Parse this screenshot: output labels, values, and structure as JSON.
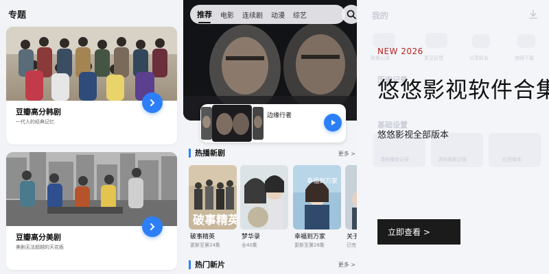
{
  "left": {
    "section_title": "专题",
    "cards": [
      {
        "title": "豆瓣高分韩剧",
        "subtitle": "一代人的经典记忆"
      },
      {
        "title": "豆瓣高分美剧",
        "subtitle": "美剧无法超越的天花板"
      }
    ]
  },
  "middle": {
    "tabs": [
      "推荐",
      "电影",
      "连续剧",
      "动漫",
      "综艺"
    ],
    "featured_title": "边缘行者",
    "hot_section": {
      "title": "热播新剧",
      "more": "更多 >"
    },
    "new_section": {
      "title": "热门新片",
      "more": "更多 >"
    },
    "posters": [
      {
        "title": "破事精英",
        "status": "更新至第24集",
        "overlay": "破事精英"
      },
      {
        "title": "梦华录",
        "status": "全40集"
      },
      {
        "title": "幸福到万家",
        "status": "更新至第28集",
        "overlay": "幸福到万家"
      },
      {
        "title": "关于",
        "status": "已完"
      }
    ]
  },
  "right": {
    "background_header": "我的",
    "background_labels": [
      "观看记录",
      "意见反馈",
      "分享好友",
      "官网下载",
      "历史记录",
      "基础设置",
      "清除播放记录",
      "清除搜索记录",
      "应用版本"
    ],
    "badge": "NEW 2026",
    "title": "悠悠影视软件合集",
    "subtitle": "悠悠影视全部版本",
    "button": "立即查看 >"
  },
  "colors": {
    "accent": "#2d7ff9",
    "ad_badge": "#b62020",
    "ad_button": "#1b1b1b"
  }
}
